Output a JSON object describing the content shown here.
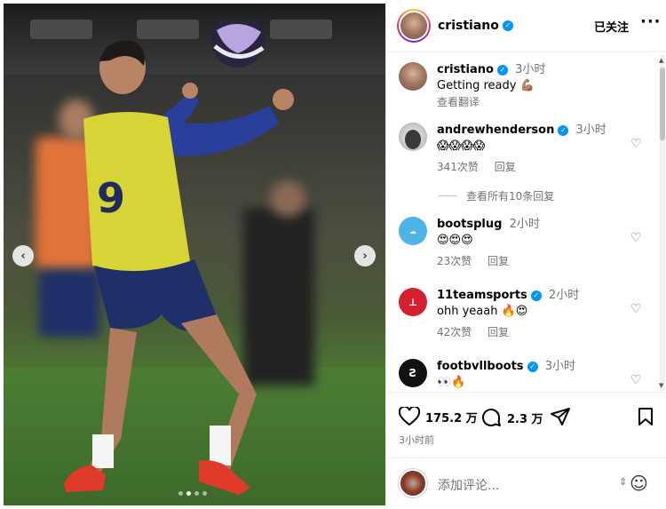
{
  "post": {
    "author": "cristiano",
    "follow_label": "已关注",
    "more_label": "···",
    "caption": {
      "username": "cristiano",
      "time": "3小时",
      "text": "Getting ready 💪🏽",
      "translate_label": "查看翻译"
    }
  },
  "comments": [
    {
      "username": "andrewhenderson",
      "verified": true,
      "time": "3小时",
      "text": "😱😱😱😱",
      "likes": "341次赞",
      "reply_label": "回复",
      "view_replies": "查看所有10条回复"
    },
    {
      "username": "bootsplug",
      "verified": false,
      "time": "2小时",
      "text": "😍😍😍",
      "likes": "23次赞",
      "reply_label": "回复"
    },
    {
      "username": "11teamsports",
      "verified": true,
      "time": "2小时",
      "text": "ohh yeaah 🔥😍",
      "likes": "42次赞",
      "reply_label": "回复"
    },
    {
      "username": "footbvllboots",
      "verified": true,
      "time": "3小时",
      "text": "👀🔥"
    }
  ],
  "actions": {
    "likes": "175.2 万",
    "comments": "2.3 万",
    "posted_time": "3小时前"
  },
  "comment_input": {
    "placeholder": "添加评论..."
  },
  "colors": {
    "verified": "#0095f6",
    "muted_text": "#737373",
    "divider": "#efefef"
  },
  "carousel": {
    "prev_icon": "chevron-left-icon",
    "next_icon": "chevron-right-icon",
    "total_slides": 4,
    "active_slide": 2
  }
}
